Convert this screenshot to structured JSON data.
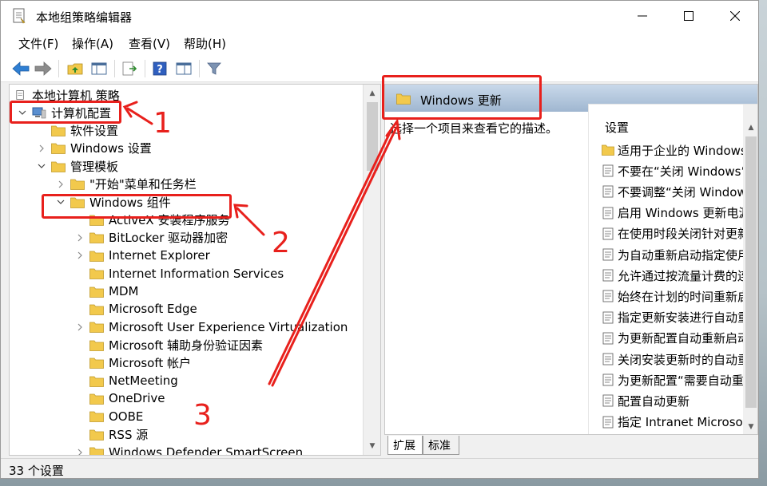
{
  "window": {
    "title": "本地组策略编辑器",
    "controls": {
      "minimize": "minimize-icon",
      "maximize": "maximize-icon",
      "close": "close-icon"
    }
  },
  "menu": {
    "items": [
      {
        "label": "文件(F)"
      },
      {
        "label": "操作(A)"
      },
      {
        "label": "查看(V)"
      },
      {
        "label": "帮助(H)"
      }
    ]
  },
  "toolbar": {
    "icons": [
      "back-icon",
      "forward-icon",
      "up-folder-icon",
      "show-hide-tree-icon",
      "export-list-icon",
      "help-icon",
      "properties-icon",
      "filter-icon"
    ]
  },
  "tree": {
    "root": "本地计算机 策略",
    "items": [
      {
        "label": "计算机配置",
        "level": 0,
        "arrow": "expanded"
      },
      {
        "label": "软件设置",
        "level": 1,
        "arrow": "none"
      },
      {
        "label": "Windows 设置",
        "level": 1,
        "arrow": "collapsed"
      },
      {
        "label": "管理模板",
        "level": 1,
        "arrow": "expanded"
      },
      {
        "label": "\"开始\"菜单和任务栏",
        "level": 2,
        "arrow": "collapsed"
      },
      {
        "label": "Windows 组件",
        "level": 2,
        "arrow": "expanded"
      },
      {
        "label": "ActiveX 安装程序服务",
        "level": 3,
        "arrow": "none"
      },
      {
        "label": "BitLocker 驱动器加密",
        "level": 3,
        "arrow": "collapsed"
      },
      {
        "label": "Internet Explorer",
        "level": 3,
        "arrow": "collapsed"
      },
      {
        "label": "Internet Information Services",
        "level": 3,
        "arrow": "none"
      },
      {
        "label": "MDM",
        "level": 3,
        "arrow": "none"
      },
      {
        "label": "Microsoft Edge",
        "level": 3,
        "arrow": "none"
      },
      {
        "label": "Microsoft User Experience Virtualization",
        "level": 3,
        "arrow": "collapsed"
      },
      {
        "label": "Microsoft 辅助身份验证因素",
        "level": 3,
        "arrow": "none"
      },
      {
        "label": "Microsoft 帐户",
        "level": 3,
        "arrow": "none"
      },
      {
        "label": "NetMeeting",
        "level": 3,
        "arrow": "none"
      },
      {
        "label": "OneDrive",
        "level": 3,
        "arrow": "none"
      },
      {
        "label": "OOBE",
        "level": 3,
        "arrow": "none"
      },
      {
        "label": "RSS 源",
        "level": 3,
        "arrow": "none"
      },
      {
        "label": "Windows Defender SmartScreen",
        "level": 3,
        "arrow": "collapsed"
      }
    ]
  },
  "details": {
    "title": "Windows 更新",
    "description": "选择一个项目来查看它的描述。",
    "column_header": "设置",
    "settings": [
      {
        "label": "适用于企业的 Windows",
        "type": "folder"
      },
      {
        "label": "不要在“关闭 Windows”",
        "type": "policy"
      },
      {
        "label": "不要调整“关闭 Window",
        "type": "policy"
      },
      {
        "label": "启用 Windows 更新电源",
        "type": "policy"
      },
      {
        "label": "在使用时段关闭针对更新",
        "type": "policy"
      },
      {
        "label": "为自动重新启动指定使用",
        "type": "policy"
      },
      {
        "label": "允许通过按流量计费的连",
        "type": "policy"
      },
      {
        "label": "始终在计划的时间重新启",
        "type": "policy"
      },
      {
        "label": "指定更新安装进行自动重",
        "type": "policy"
      },
      {
        "label": "为更新配置自动重新启动",
        "type": "policy"
      },
      {
        "label": "关闭安装更新时的自动重",
        "type": "policy"
      },
      {
        "label": "为更新配置“需要自动重",
        "type": "policy"
      },
      {
        "label": "配置自动更新",
        "type": "policy"
      },
      {
        "label": "指定 Intranet Microsoft",
        "type": "policy"
      }
    ]
  },
  "tabs": [
    {
      "label": "扩展"
    },
    {
      "label": "标准"
    }
  ],
  "status": {
    "text": "33 个设置"
  },
  "annotations": {
    "labels": [
      "1",
      "2",
      "3"
    ],
    "color": "#e8201c"
  },
  "colors": {
    "header_gradient_top": "#c9d9ea",
    "header_gradient_bottom": "#9fb6d0",
    "folder": "#f2c94c"
  }
}
